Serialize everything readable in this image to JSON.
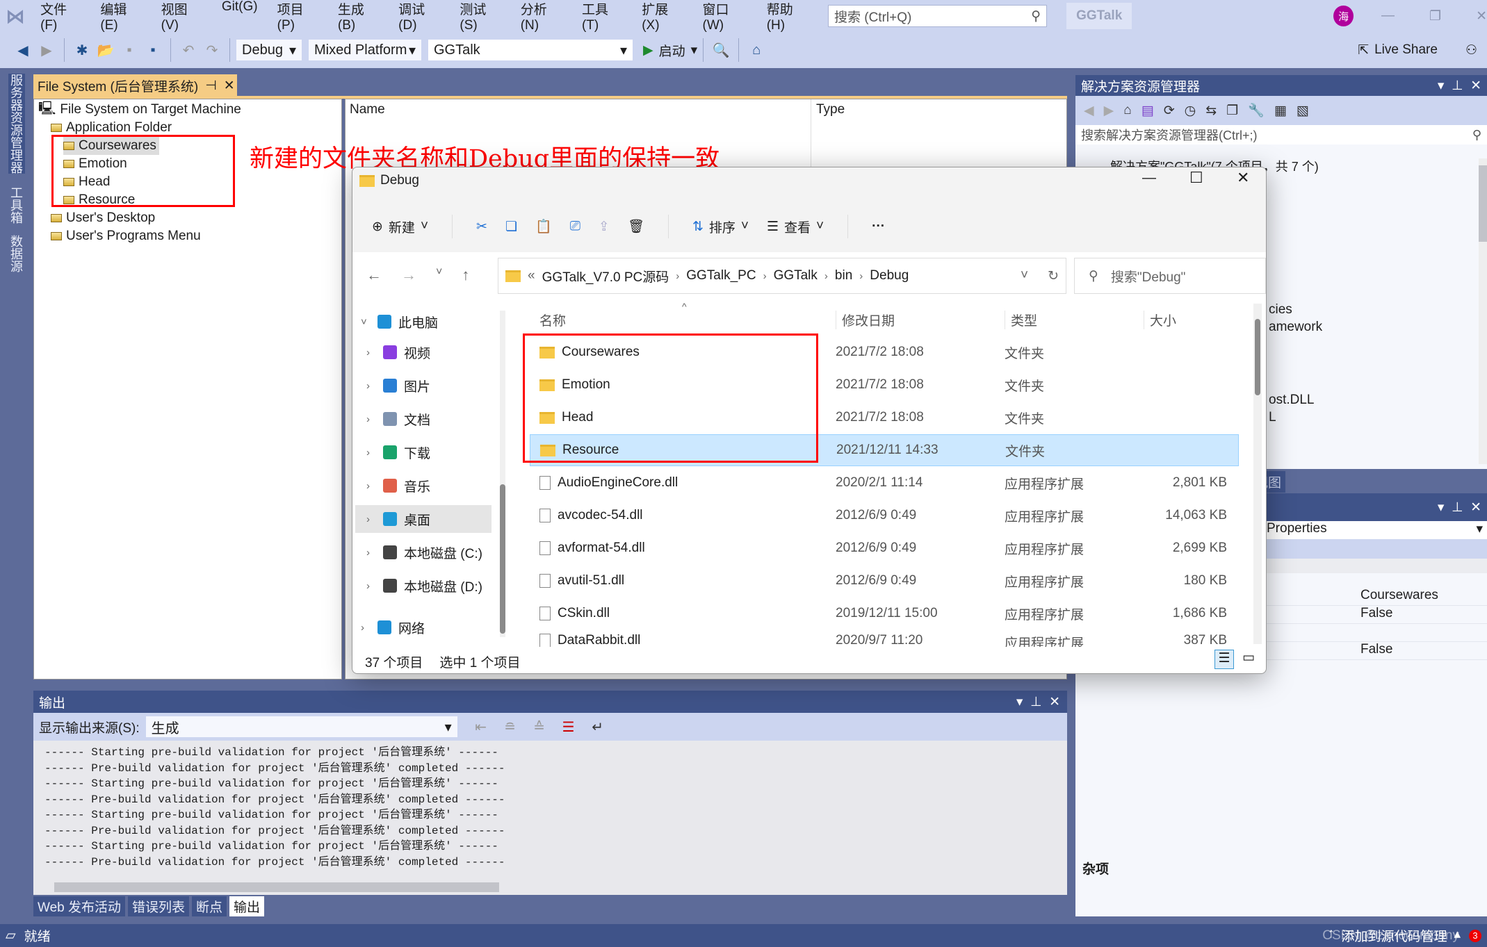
{
  "menu": {
    "items": [
      "文件(F)",
      "编辑(E)",
      "视图(V)",
      "Git(G)",
      "项目(P)",
      "生成(B)",
      "调试(D)",
      "测试(S)",
      "分析(N)",
      "工具(T)",
      "扩展(X)",
      "窗口(W)",
      "帮助(H)"
    ],
    "search_placeholder": "搜索 (Ctrl+Q)",
    "solution_name": "GGTalk",
    "avatar": "海"
  },
  "toolbar": {
    "config": "Debug",
    "platform": "Mixed Platform",
    "project": "GGTalk",
    "start": "启动",
    "live_share": "Live Share"
  },
  "side_tabs": [
    "服务器资源管理器",
    "工具箱",
    "数据源"
  ],
  "fs_panel": {
    "tab": "File System (后台管理系统)",
    "root": "File System on Target Machine",
    "app_folder": "Application Folder",
    "children": [
      "Coursewares",
      "Emotion",
      "Head",
      "Resource"
    ],
    "desktop": "User's Desktop",
    "programs": "User's Programs Menu",
    "col_name": "Name",
    "col_type": "Type"
  },
  "annotation": {
    "text": "新建的文件夹名称和Debug里面的保持一致",
    "color": "#ff0000"
  },
  "explorer": {
    "title": "Debug",
    "new": "新建",
    "sort": "排序",
    "view": "查看",
    "more": "···",
    "path": [
      "GGTalk_V7.0 PC源码",
      "GGTalk_PC",
      "GGTalk",
      "bin",
      "Debug"
    ],
    "search_placeholder": "搜索\"Debug\"",
    "cols": [
      "名称",
      "修改日期",
      "类型",
      "大小"
    ],
    "nav": [
      {
        "label": "此电脑",
        "color": "#1e90d6"
      },
      {
        "label": "视频",
        "color": "#8a3ee0"
      },
      {
        "label": "图片",
        "color": "#2a7fd4"
      },
      {
        "label": "文档",
        "color": "#7f93b0"
      },
      {
        "label": "下载",
        "color": "#1aa36b"
      },
      {
        "label": "音乐",
        "color": "#e0604a"
      },
      {
        "label": "桌面",
        "color": "#1e9ad6"
      },
      {
        "label": "本地磁盘 (C:)",
        "color": "#444"
      },
      {
        "label": "本地磁盘 (D:)",
        "color": "#444"
      },
      {
        "label": "网络",
        "color": "#1e90d6"
      }
    ],
    "files": [
      {
        "name": "Coursewares",
        "date": "2021/7/2 18:08",
        "type": "文件夹",
        "size": "",
        "folder": true
      },
      {
        "name": "Emotion",
        "date": "2021/7/2 18:08",
        "type": "文件夹",
        "size": "",
        "folder": true
      },
      {
        "name": "Head",
        "date": "2021/7/2 18:08",
        "type": "文件夹",
        "size": "",
        "folder": true
      },
      {
        "name": "Resource",
        "date": "2021/12/11 14:33",
        "type": "文件夹",
        "size": "",
        "folder": true,
        "selected": true
      },
      {
        "name": "AudioEngineCore.dll",
        "date": "2020/2/1 11:14",
        "type": "应用程序扩展",
        "size": "2,801 KB"
      },
      {
        "name": "avcodec-54.dll",
        "date": "2012/6/9 0:49",
        "type": "应用程序扩展",
        "size": "14,063 KB"
      },
      {
        "name": "avformat-54.dll",
        "date": "2012/6/9 0:49",
        "type": "应用程序扩展",
        "size": "2,699 KB"
      },
      {
        "name": "avutil-51.dll",
        "date": "2012/6/9 0:49",
        "type": "应用程序扩展",
        "size": "180 KB"
      },
      {
        "name": "CSkin.dll",
        "date": "2019/12/11 15:00",
        "type": "应用程序扩展",
        "size": "1,686 KB"
      },
      {
        "name": "DataRabbit.dll",
        "date": "2020/9/7 11:20",
        "type": "应用程序扩展",
        "size": "387 KB"
      }
    ],
    "status_count": "37 个项目",
    "status_selected": "选中 1 个项目"
  },
  "solution": {
    "title": "解决方案资源管理器",
    "search_placeholder": "搜索解决方案资源管理器(Ctrl+;)",
    "root": "解决方案\"GGTalk\"(7 个项目，共 7 个)",
    "partial": [
      "cies",
      "amework",
      "ost.DLL",
      "L"
    ],
    "class_view": "类视图"
  },
  "properties": {
    "selector": "Properties",
    "values": [
      "Coursewares",
      "False",
      "",
      "False"
    ],
    "category": "杂项"
  },
  "output": {
    "title": "输出",
    "source_label": "显示输出来源(S):",
    "source": "生成",
    "lines": [
      "------ Starting pre-build validation for project '后台管理系统' ------",
      "------ Pre-build validation for project '后台管理系统' completed ------",
      "------ Starting pre-build validation for project '后台管理系统' ------",
      "------ Pre-build validation for project '后台管理系统' completed ------",
      "------ Starting pre-build validation for project '后台管理系统' ------",
      "------ Pre-build validation for project '后台管理系统' completed ------",
      "------ Starting pre-build validation for project '后台管理系统' ------",
      "------ Pre-build validation for project '后台管理系统' completed ------"
    ],
    "tabs": [
      "Web 发布活动",
      "错误列表",
      "断点",
      "输出"
    ]
  },
  "statusbar": {
    "ready": "就绪",
    "source_control": "添加到源代码管理",
    "notifications": "3",
    "watermark": "CSDN @zenocompany"
  }
}
